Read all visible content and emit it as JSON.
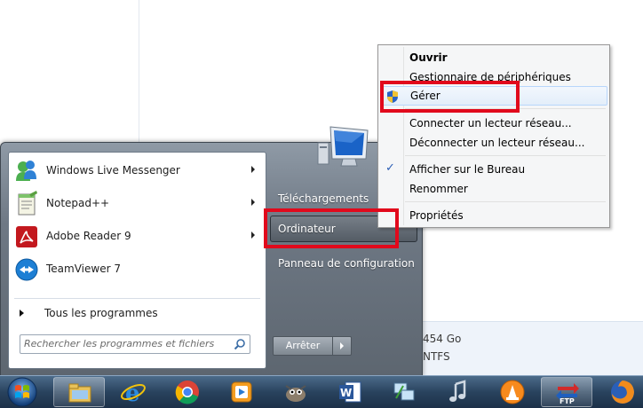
{
  "background": {
    "details_size": "454 Go",
    "details_fs": "NTFS"
  },
  "start_menu": {
    "programs": [
      {
        "label": "Windows Live Messenger",
        "icon": "messenger-icon",
        "has_submenu": true
      },
      {
        "label": "Notepad++",
        "icon": "notepad-plus-plus-icon",
        "has_submenu": true
      },
      {
        "label": "Adobe Reader 9",
        "icon": "adobe-reader-icon",
        "has_submenu": true
      },
      {
        "label": "TeamViewer 7",
        "icon": "teamviewer-icon",
        "has_submenu": false
      }
    ],
    "all_programs": "Tous les programmes",
    "search_placeholder": "Rechercher les programmes et fichiers",
    "right_links": {
      "downloads": "Téléchargements",
      "computer": "Ordinateur",
      "control_panel": "Panneau de configuration"
    },
    "shutdown_label": "Arrêter"
  },
  "context_menu": {
    "items": [
      {
        "label": "Ouvrir",
        "bold": true
      },
      {
        "label": "Gestionnaire de périphériques"
      },
      {
        "label": "Gérer",
        "icon": "shield-icon",
        "hover": true
      },
      {
        "label": "Connecter un lecteur réseau..."
      },
      {
        "label": "Déconnecter un lecteur réseau..."
      },
      {
        "label": "Afficher sur le Bureau",
        "checked": true
      },
      {
        "label": "Renommer"
      },
      {
        "label": "Propriétés"
      }
    ]
  },
  "taskbar": {
    "apps": [
      "windows-explorer-icon",
      "internet-explorer-icon",
      "chrome-icon",
      "media-player-icon",
      "gimp-icon",
      "word-icon",
      "network-icon",
      "itunes-icon",
      "vlc-icon",
      "ftp-icon",
      "firefox-icon"
    ],
    "ftp_badge": "FTP"
  },
  "colors": {
    "highlight": "#e1091c",
    "taskbar": "#29435e"
  }
}
